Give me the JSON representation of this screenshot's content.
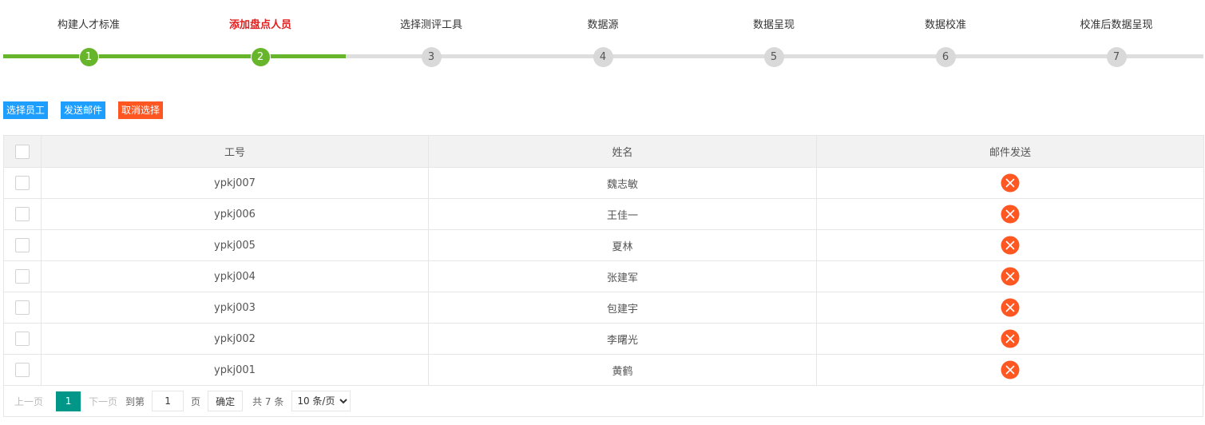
{
  "stepper": {
    "steps": [
      {
        "label": "构建人才标准",
        "number": "1",
        "state": "done"
      },
      {
        "label": "添加盘点人员",
        "number": "2",
        "state": "active"
      },
      {
        "label": "选择测评工具",
        "number": "3",
        "state": "pending"
      },
      {
        "label": "数据源",
        "number": "4",
        "state": "pending"
      },
      {
        "label": "数据呈现",
        "number": "5",
        "state": "pending"
      },
      {
        "label": "数据校准",
        "number": "6",
        "state": "pending"
      },
      {
        "label": "校准后数据呈现",
        "number": "7",
        "state": "pending"
      }
    ],
    "progress_completed_steps": 2,
    "colors": {
      "done": "#67b52b",
      "pending": "#dedede",
      "active_label": "#e02020"
    }
  },
  "toolbar": {
    "select_employee_label": "选择员工",
    "send_mail_label": "发送邮件",
    "cancel_selection_label": "取消选择",
    "colors": {
      "primary": "#1e9fff",
      "danger": "#ff5722"
    }
  },
  "table": {
    "headers": {
      "employee_id": "工号",
      "name": "姓名",
      "mail_status": "邮件发送"
    },
    "rows": [
      {
        "employee_id": "ypkj007",
        "name": "魏志敏",
        "mail_status_icon": "error-circle-icon"
      },
      {
        "employee_id": "ypkj006",
        "name": "王佳一",
        "mail_status_icon": "error-circle-icon"
      },
      {
        "employee_id": "ypkj005",
        "name": "夏林",
        "mail_status_icon": "error-circle-icon"
      },
      {
        "employee_id": "ypkj004",
        "name": "张建军",
        "mail_status_icon": "error-circle-icon"
      },
      {
        "employee_id": "ypkj003",
        "name": "包建宇",
        "mail_status_icon": "error-circle-icon"
      },
      {
        "employee_id": "ypkj002",
        "name": "李曙光",
        "mail_status_icon": "error-circle-icon"
      },
      {
        "employee_id": "ypkj001",
        "name": "黄鹤",
        "mail_status_icon": "error-circle-icon"
      }
    ],
    "error_icon_color": "#ff5722"
  },
  "pager": {
    "prev_label": "上一页",
    "current_page": "1",
    "next_label": "下一页",
    "goto_label": "到第",
    "goto_value": "1",
    "page_unit": "页",
    "confirm_label": "确定",
    "total_label": "共 7 条",
    "page_size_selected": "10 条/页",
    "current_color": "#009688"
  }
}
